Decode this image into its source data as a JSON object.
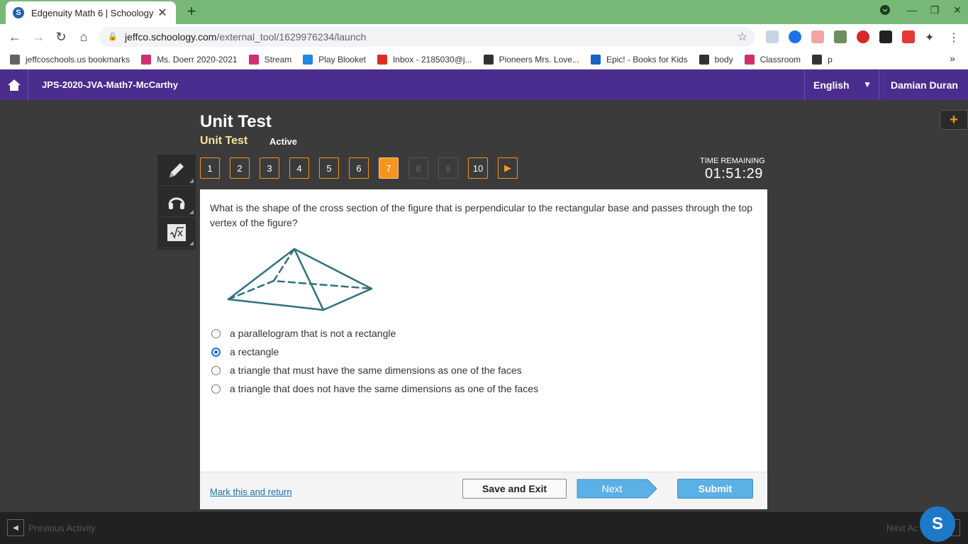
{
  "browser": {
    "tab_title": "Edgenuity Math 6 | Schoology",
    "tab_favicon": "S",
    "url_host": "jeffco.schoology.com",
    "url_path": "/external_tool/1629976234/launch",
    "bookmarks": [
      {
        "label": "jeffcoschools.us bookmarks",
        "color": "#5f6368"
      },
      {
        "label": "Ms. Doerr 2020-2021",
        "color": "#d0306f"
      },
      {
        "label": "Stream",
        "color": "#d0306f"
      },
      {
        "label": "Play Blooket",
        "color": "#1e88e5"
      },
      {
        "label": "Inbox - 2185030@j...",
        "color": "#d93025"
      },
      {
        "label": "Pioneers Mrs. Love...",
        "color": "#333333"
      },
      {
        "label": "Epic! - Books for Kids",
        "color": "#1565c0"
      },
      {
        "label": "body",
        "color": "#333333"
      },
      {
        "label": "Classroom",
        "color": "#d0306f"
      },
      {
        "label": "p",
        "color": "#333333"
      }
    ],
    "bookmarks_more": "»"
  },
  "appbar": {
    "course": "JPS-2020-JVA-Math7-McCarthy",
    "language": "English",
    "user": "Damian Duran"
  },
  "test": {
    "title": "Unit Test",
    "subtitle": "Unit Test",
    "status": "Active",
    "timer_label": "TIME REMAINING",
    "timer": "01:51:29",
    "questions": [
      {
        "label": "1",
        "state": "normal"
      },
      {
        "label": "2",
        "state": "normal"
      },
      {
        "label": "3",
        "state": "normal"
      },
      {
        "label": "4",
        "state": "normal"
      },
      {
        "label": "5",
        "state": "normal"
      },
      {
        "label": "6",
        "state": "normal"
      },
      {
        "label": "7",
        "state": "active"
      },
      {
        "label": "8",
        "state": "disabled"
      },
      {
        "label": "9",
        "state": "disabled"
      },
      {
        "label": "10",
        "state": "normal"
      }
    ]
  },
  "question": {
    "text": "What is the shape of the cross section of the figure that is perpendicular to the rectangular base and passes through the top vertex of the figure?",
    "choices": [
      {
        "label": "a parallelogram that is not a rectangle",
        "selected": false
      },
      {
        "label": "a rectangle",
        "selected": true
      },
      {
        "label": "a triangle that must have the same dimensions as one of the faces",
        "selected": false
      },
      {
        "label": "a triangle that does not have the same dimensions as one of the faces",
        "selected": false
      }
    ]
  },
  "footer": {
    "mark_link": "Mark this and return",
    "save_exit": "Save and Exit",
    "next": "Next",
    "submit": "Submit"
  },
  "bottom": {
    "previous": "Previous Activity",
    "next": "Next Ac",
    "badge": "S"
  },
  "colors": {
    "accent": "#f7941d",
    "appbar": "#4a2d8e",
    "button_blue": "#5bb0e6",
    "figure_stroke": "#2f7080"
  }
}
